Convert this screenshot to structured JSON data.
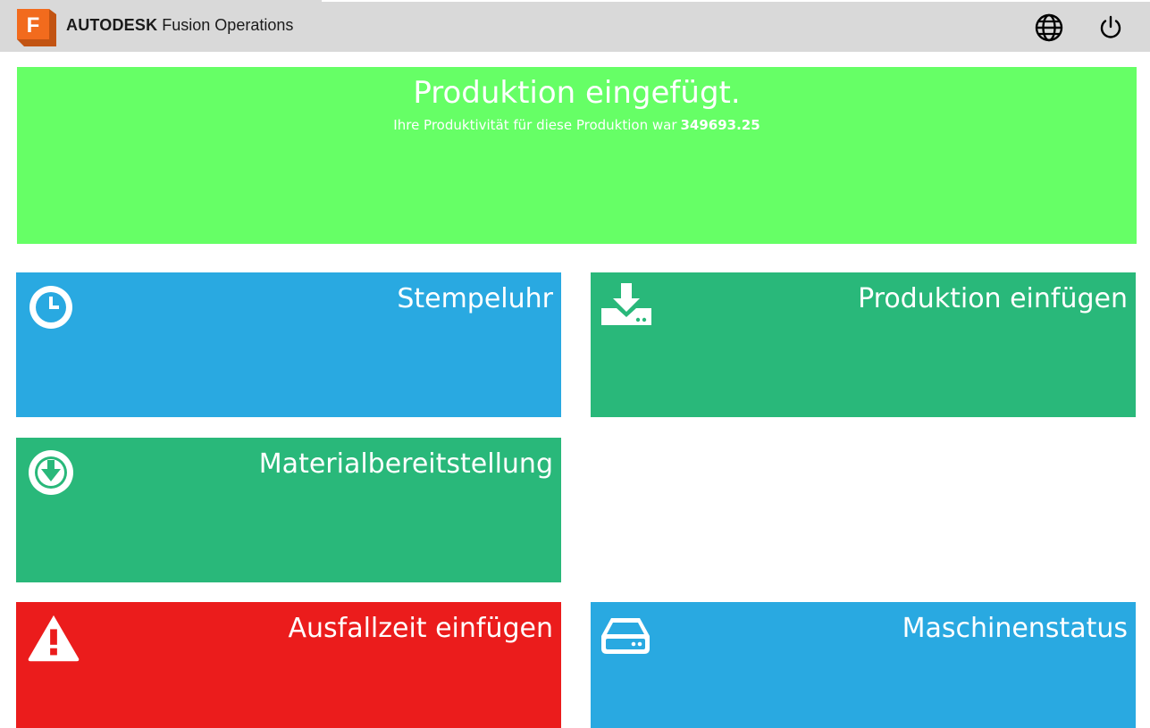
{
  "app": {
    "brand_strong": "AUTODESK",
    "brand_light": "Fusion Operations",
    "logo_letter": "F",
    "accent_color": "#f26b1d"
  },
  "header": {
    "globe_icon": "globe-icon",
    "power_icon": "power-icon"
  },
  "banner": {
    "title": "Produktion eingefügt.",
    "subtitle": "Ihre Produktivität für diese Produktion war",
    "value": "349693.25",
    "color": "#66ff66"
  },
  "tiles": [
    {
      "label": "Stempeluhr",
      "icon": "clock-icon",
      "color": "#29a9e1"
    },
    {
      "label": "Produktion einfügen",
      "icon": "download-tray-icon",
      "color": "#29b87a"
    },
    {
      "label": "Materialbereitstellung",
      "icon": "arrow-down-circle-icon",
      "color": "#29b87a"
    },
    {
      "label": "Ausfallzeit einfügen",
      "icon": "warning-icon",
      "color": "#eb1c1c"
    },
    {
      "label": "Maschinenstatus",
      "icon": "hard-drive-icon",
      "color": "#29a9e1"
    }
  ]
}
